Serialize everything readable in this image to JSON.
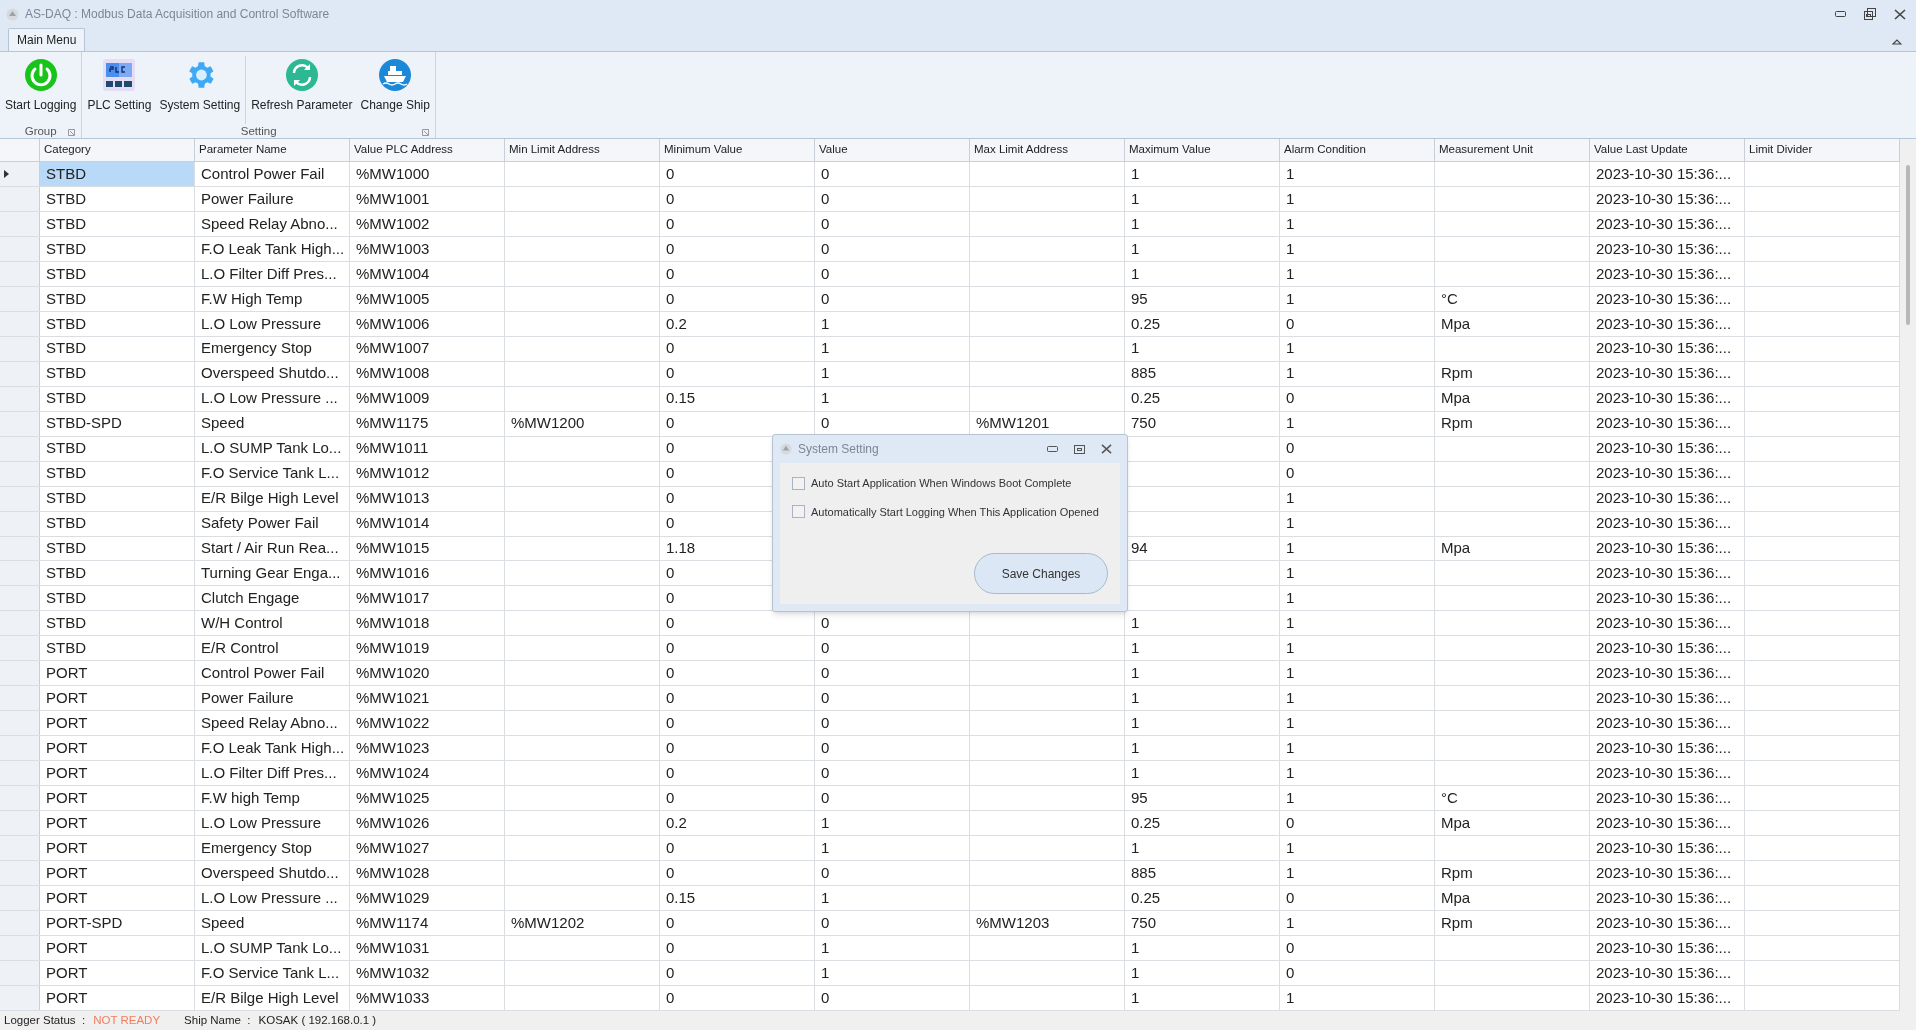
{
  "window": {
    "title": "AS-DAQ : Modbus Data Acquisition and Control Software"
  },
  "ribbon": {
    "tabs": [
      {
        "label": "Main Menu",
        "selected": true
      }
    ],
    "groups": [
      {
        "label": "Group",
        "sections": [
          [
            {
              "label": "Start Logging",
              "kind": "power"
            }
          ]
        ]
      },
      {
        "label": "Setting",
        "sections": [
          [
            {
              "label": "PLC Setting",
              "kind": "plc"
            },
            {
              "label": "System Setting",
              "kind": "gear"
            }
          ],
          [
            {
              "label": "Refresh Parameter",
              "kind": "refresh"
            },
            {
              "label": "Change Ship",
              "kind": "ship"
            }
          ]
        ]
      }
    ]
  },
  "table": {
    "columns": [
      "Category",
      "Parameter Name",
      "Value PLC Address",
      "Min Limit Address",
      "Minimum Value",
      "Value",
      "Max Limit Address",
      "Maximum Value",
      "Alarm Condition",
      "Measurement Unit",
      "Value Last Update",
      "Limit Divider"
    ],
    "rows": [
      {
        "selected": true,
        "cells": [
          "STBD",
          "Control Power Fail",
          "%MW1000",
          null,
          "0",
          "0",
          null,
          "1",
          "1",
          null,
          "2023-10-30 15:36:...",
          null
        ]
      },
      {
        "selected": false,
        "cells": [
          "STBD",
          "Power Failure",
          "%MW1001",
          null,
          "0",
          "0",
          null,
          "1",
          "1",
          null,
          "2023-10-30 15:36:...",
          null
        ]
      },
      {
        "selected": false,
        "cells": [
          "STBD",
          "Speed Relay Abno...",
          "%MW1002",
          null,
          "0",
          "0",
          null,
          "1",
          "1",
          null,
          "2023-10-30 15:36:...",
          null
        ]
      },
      {
        "selected": false,
        "cells": [
          "STBD",
          "F.O Leak Tank High...",
          "%MW1003",
          null,
          "0",
          "0",
          null,
          "1",
          "1",
          null,
          "2023-10-30 15:36:...",
          null
        ]
      },
      {
        "selected": false,
        "cells": [
          "STBD",
          "L.O Filter Diff Pres...",
          "%MW1004",
          null,
          "0",
          "0",
          null,
          "1",
          "1",
          null,
          "2023-10-30 15:36:...",
          null
        ]
      },
      {
        "selected": false,
        "cells": [
          "STBD",
          "F.W High Temp",
          "%MW1005",
          null,
          "0",
          "0",
          null,
          "95",
          "1",
          "°C",
          "2023-10-30 15:36:...",
          null
        ]
      },
      {
        "selected": false,
        "cells": [
          "STBD",
          "L.O Low Pressure",
          "%MW1006",
          null,
          "0.2",
          "1",
          null,
          "0.25",
          "0",
          "Mpa",
          "2023-10-30 15:36:...",
          null
        ]
      },
      {
        "selected": false,
        "cells": [
          "STBD",
          "Emergency Stop",
          "%MW1007",
          null,
          "0",
          "1",
          null,
          "1",
          "1",
          null,
          "2023-10-30 15:36:...",
          null
        ]
      },
      {
        "selected": false,
        "cells": [
          "STBD",
          "Overspeed Shutdo...",
          "%MW1008",
          null,
          "0",
          "1",
          null,
          "885",
          "1",
          "Rpm",
          "2023-10-30 15:36:...",
          null
        ]
      },
      {
        "selected": false,
        "cells": [
          "STBD",
          "L.O Low Pressure ...",
          "%MW1009",
          null,
          "0.15",
          "1",
          null,
          "0.25",
          "0",
          "Mpa",
          "2023-10-30 15:36:...",
          null
        ]
      },
      {
        "selected": false,
        "cells": [
          "STBD-SPD",
          "Speed",
          "%MW1175",
          "%MW1200",
          "0",
          "0",
          "%MW1201",
          "750",
          "1",
          "Rpm",
          "2023-10-30 15:36:...",
          null
        ]
      },
      {
        "selected": false,
        "cells": [
          "STBD",
          "L.O SUMP Tank Lo...",
          "%MW1011",
          null,
          "0",
          null,
          null,
          null,
          "0",
          null,
          "2023-10-30 15:36:...",
          null
        ]
      },
      {
        "selected": false,
        "cells": [
          "STBD",
          "F.O Service Tank L...",
          "%MW1012",
          null,
          "0",
          null,
          null,
          null,
          "0",
          null,
          "2023-10-30 15:36:...",
          null
        ]
      },
      {
        "selected": false,
        "cells": [
          "STBD",
          "E/R Bilge High Level",
          "%MW1013",
          null,
          "0",
          null,
          null,
          null,
          "1",
          null,
          "2023-10-30 15:36:...",
          null
        ]
      },
      {
        "selected": false,
        "cells": [
          "STBD",
          "Safety Power Fail",
          "%MW1014",
          null,
          "0",
          null,
          null,
          null,
          "1",
          null,
          "2023-10-30 15:36:...",
          null
        ]
      },
      {
        "selected": false,
        "cells": [
          "STBD",
          "Start / Air Run Rea...",
          "%MW1015",
          null,
          "1.18",
          null,
          null,
          "94",
          "1",
          "Mpa",
          "2023-10-30 15:36:...",
          null
        ]
      },
      {
        "selected": false,
        "cells": [
          "STBD",
          "Turning Gear Enga...",
          "%MW1016",
          null,
          "0",
          null,
          null,
          null,
          "1",
          null,
          "2023-10-30 15:36:...",
          null
        ]
      },
      {
        "selected": false,
        "cells": [
          "STBD",
          "Clutch Engage",
          "%MW1017",
          null,
          "0",
          null,
          null,
          null,
          "1",
          null,
          "2023-10-30 15:36:...",
          null
        ]
      },
      {
        "selected": false,
        "cells": [
          "STBD",
          "W/H Control",
          "%MW1018",
          null,
          "0",
          "0",
          null,
          "1",
          "1",
          null,
          "2023-10-30 15:36:...",
          null
        ]
      },
      {
        "selected": false,
        "cells": [
          "STBD",
          "E/R Control",
          "%MW1019",
          null,
          "0",
          "0",
          null,
          "1",
          "1",
          null,
          "2023-10-30 15:36:...",
          null
        ]
      },
      {
        "selected": false,
        "cells": [
          "PORT",
          "Control Power Fail",
          "%MW1020",
          null,
          "0",
          "0",
          null,
          "1",
          "1",
          null,
          "2023-10-30 15:36:...",
          null
        ]
      },
      {
        "selected": false,
        "cells": [
          "PORT",
          "Power Failure",
          "%MW1021",
          null,
          "0",
          "0",
          null,
          "1",
          "1",
          null,
          "2023-10-30 15:36:...",
          null
        ]
      },
      {
        "selected": false,
        "cells": [
          "PORT",
          "Speed Relay Abno...",
          "%MW1022",
          null,
          "0",
          "0",
          null,
          "1",
          "1",
          null,
          "2023-10-30 15:36:...",
          null
        ]
      },
      {
        "selected": false,
        "cells": [
          "PORT",
          "F.O Leak Tank High...",
          "%MW1023",
          null,
          "0",
          "0",
          null,
          "1",
          "1",
          null,
          "2023-10-30 15:36:...",
          null
        ]
      },
      {
        "selected": false,
        "cells": [
          "PORT",
          "L.O Filter Diff Pres...",
          "%MW1024",
          null,
          "0",
          "0",
          null,
          "1",
          "1",
          null,
          "2023-10-30 15:36:...",
          null
        ]
      },
      {
        "selected": false,
        "cells": [
          "PORT",
          "F.W high Temp",
          "%MW1025",
          null,
          "0",
          "0",
          null,
          "95",
          "1",
          "°C",
          "2023-10-30 15:36:...",
          null
        ]
      },
      {
        "selected": false,
        "cells": [
          "PORT",
          "L.O Low Pressure",
          "%MW1026",
          null,
          "0.2",
          "1",
          null,
          "0.25",
          "0",
          "Mpa",
          "2023-10-30 15:36:...",
          null
        ]
      },
      {
        "selected": false,
        "cells": [
          "PORT",
          "Emergency Stop",
          "%MW1027",
          null,
          "0",
          "1",
          null,
          "1",
          "1",
          null,
          "2023-10-30 15:36:...",
          null
        ]
      },
      {
        "selected": false,
        "cells": [
          "PORT",
          "Overspeed Shutdo...",
          "%MW1028",
          null,
          "0",
          "0",
          null,
          "885",
          "1",
          "Rpm",
          "2023-10-30 15:36:...",
          null
        ]
      },
      {
        "selected": false,
        "cells": [
          "PORT",
          "L.O Low Pressure ...",
          "%MW1029",
          null,
          "0.15",
          "1",
          null,
          "0.25",
          "0",
          "Mpa",
          "2023-10-30 15:36:...",
          null
        ]
      },
      {
        "selected": false,
        "cells": [
          "PORT-SPD",
          "Speed",
          "%MW1174",
          "%MW1202",
          "0",
          "0",
          "%MW1203",
          "750",
          "1",
          "Rpm",
          "2023-10-30 15:36:...",
          null
        ]
      },
      {
        "selected": false,
        "cells": [
          "PORT",
          "L.O SUMP Tank Lo...",
          "%MW1031",
          null,
          "0",
          "1",
          null,
          "1",
          "0",
          null,
          "2023-10-30 15:36:...",
          null
        ]
      },
      {
        "selected": false,
        "cells": [
          "PORT",
          "F.O Service Tank L...",
          "%MW1032",
          null,
          "0",
          "1",
          null,
          "1",
          "0",
          null,
          "2023-10-30 15:36:...",
          null
        ]
      },
      {
        "selected": false,
        "cells": [
          "PORT",
          "E/R Bilge High Level",
          "%MW1033",
          null,
          "0",
          "0",
          null,
          "1",
          "1",
          null,
          "2023-10-30 15:36:...",
          null
        ]
      }
    ]
  },
  "dialog": {
    "title": "System Setting",
    "options": [
      {
        "label": "Auto Start Application When Windows Boot Complete",
        "checked": false
      },
      {
        "label": "Automatically Start Logging When This Application Opened",
        "checked": false
      }
    ],
    "button": "Save Changes"
  },
  "status_bar": [
    {
      "label": "Logger Status  :",
      "value": "NOT READY",
      "kind": "alert"
    },
    {
      "label": "Ship Name  :",
      "value": "KOSAK ( 192.168.0.1 )",
      "kind": "normal"
    }
  ]
}
